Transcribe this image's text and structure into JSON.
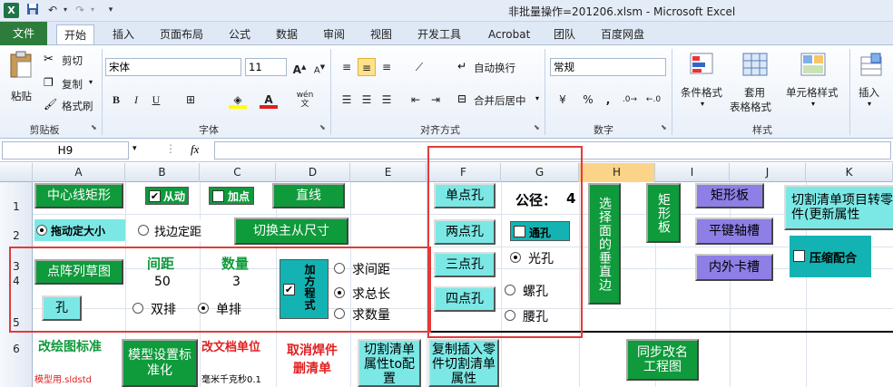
{
  "window": {
    "title": "非批量操作=201206.xlsm  -  Microsoft Excel"
  },
  "quick_access": {
    "save_icon": "save-icon",
    "undo_icon": "undo-icon",
    "redo_icon": "redo-icon",
    "customize_icon": "chevron-down-icon"
  },
  "tabs": [
    "文件",
    "开始",
    "插入",
    "页面布局",
    "公式",
    "数据",
    "审阅",
    "视图",
    "开发工具",
    "Acrobat",
    "团队",
    "百度网盘"
  ],
  "active_tab": "开始",
  "ribbon": {
    "clipboard": {
      "paste": "粘贴",
      "cut": "剪切",
      "copy": "复制",
      "format_painter": "格式刷",
      "label": "剪贴板"
    },
    "font": {
      "name": "宋体",
      "size": "11",
      "bold": "B",
      "italic": "I",
      "underline": "U",
      "label": "字体"
    },
    "alignment": {
      "wrap": "自动换行",
      "merge": "合并后居中",
      "label": "对齐方式"
    },
    "number": {
      "format": "常规",
      "label": "数字"
    },
    "styles": {
      "conditional": "条件格式",
      "table_line1": "套用",
      "table_line2": "表格格式",
      "cell_styles": "单元格样式",
      "label": "样式"
    },
    "cells": {
      "insert": "插入"
    }
  },
  "formula_bar": {
    "name_box": "H9",
    "fx": "fx",
    "value": ""
  },
  "columns": [
    "A",
    "B",
    "C",
    "D",
    "E",
    "F",
    "G",
    "H",
    "I",
    "J",
    "K"
  ],
  "selected_column": "H",
  "rows": [
    "1",
    "2",
    "3",
    "4",
    "5",
    "6"
  ],
  "sheet": {
    "center_rect_btn": "中心线矩形",
    "follow_chk": "从动",
    "point_chk": "加点",
    "line_btn": "直线",
    "drag_size_radio": "拖动定大小",
    "find_edge_radio": "找边定距",
    "switch_dim_btn": "切换主从尺寸",
    "dot_array_btn": "点阵列草图",
    "spacing_label": "间距",
    "count_label": "数量",
    "spacing_value": "50",
    "count_value": "3",
    "equation_chk": "加方程式",
    "calc_spacing_radio": "求间距",
    "calc_length_radio": "求总长",
    "calc_count_radio": "求数量",
    "hole_btn": "孔",
    "double_row_radio": "双排",
    "single_row_radio": "单排",
    "single_hole_btn": "单点孔",
    "two_hole_btn": "两点孔",
    "three_hole_btn": "三点孔",
    "four_hole_btn": "四点孔",
    "tolerance_label": "公径：",
    "tolerance_value": "4",
    "through_hole_chk": "通孔",
    "smooth_hole_radio": "光孔",
    "thread_hole_radio": "螺孔",
    "slot_hole_radio": "腰孔",
    "select_face_btn": "选择面的垂直边",
    "rect_plate_btn": "矩形板",
    "rect_plate_btn2": "矩形板",
    "key_slot_btn": "平键轴槽",
    "clip_slot_btn": "内外卡槽",
    "cutlist_btn": "切割清单项目转零件(更新属性",
    "compress_fit_chk": "压缩配合",
    "change_drawing_std": "改绘图标准",
    "model_template": "模型用.sldstd",
    "model_settings_btn": "模型设置标准化",
    "change_doc_unit": "改文档单位",
    "unit_desc": "毫米千克秒0.1",
    "cancel_weld": "取消焊件删清单",
    "cutlist_props_btn": "切割清单属性to配置",
    "copy_insert_btn": "复制插入零件切割清单属性",
    "sync_rename_btn": "同步改名工程图"
  }
}
